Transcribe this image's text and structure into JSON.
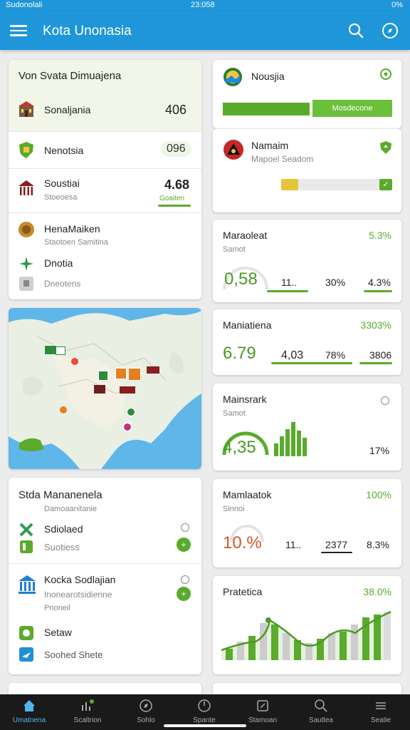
{
  "status": {
    "left": "Sudonolali",
    "time": "23:058",
    "right": "0%"
  },
  "appbar": {
    "title": "Kota Unonasia"
  },
  "list_card": {
    "header": "Von Svata Dimuajena",
    "header_item": {
      "label": "Sonaljania",
      "value": "406"
    },
    "items": [
      {
        "label": "Nenotsia",
        "value": "096"
      },
      {
        "label": "Soustiai",
        "sub": "Stoeoesa",
        "value": "4.68",
        "value_sub": "Goaiten"
      },
      {
        "label": "HenaMaiken",
        "sub": "Staotoen Samitina"
      },
      {
        "label": "Dnotia"
      },
      {
        "label": "Dneotens"
      }
    ]
  },
  "card_a": {
    "label": "Nousjia",
    "bar_label": "Mosdecone"
  },
  "card_b": {
    "label": "Namaim",
    "sub": "Mapoel Seadom"
  },
  "metric1": {
    "title": "Maraoleat",
    "sub": "Samot",
    "pct": "5.3%",
    "big": "0,58",
    "mid": "11..",
    "v3": "30%",
    "v4": "4.3%"
  },
  "metric2": {
    "title": "Maniatiena",
    "pct": "3303%",
    "big": "6.79",
    "mid": "4,03",
    "v3": "78%",
    "v4": "3806"
  },
  "metric3": {
    "title": "Mainsrark",
    "sub": "Samot",
    "big": "4,35",
    "v3": "17%"
  },
  "metric4": {
    "title": "Mamlaatok",
    "sub": "Sinnoi",
    "pct": "100%",
    "big": "10.%",
    "mid": "11..",
    "v3": "2377",
    "v4": "8.3%"
  },
  "metric5": {
    "title": "Pratetica",
    "pct": "38.0%"
  },
  "bottom_list": {
    "header": "Stda Mananenela",
    "header_sub": "Damoaanitanie",
    "items": [
      {
        "label": "Sdiolaed"
      },
      {
        "label": "Suotiess"
      },
      {
        "label": "Kocka Sodlajian",
        "sub": "Inonearotsidienne",
        "sub2": "Pnoneil"
      },
      {
        "label": "Setaw"
      },
      {
        "label": "Soohed Shete"
      }
    ]
  },
  "nav": [
    {
      "label": "Umatnena"
    },
    {
      "label": "Scaltrion"
    },
    {
      "label": "Sohlo"
    },
    {
      "label": "Spante"
    },
    {
      "label": "Stamoan"
    },
    {
      "label": "Sautlea"
    },
    {
      "label": "Seatie"
    }
  ],
  "colors": {
    "primary": "#1e96d9",
    "accent_green": "#5aab2c",
    "nav_bg": "#1a1a1a"
  }
}
